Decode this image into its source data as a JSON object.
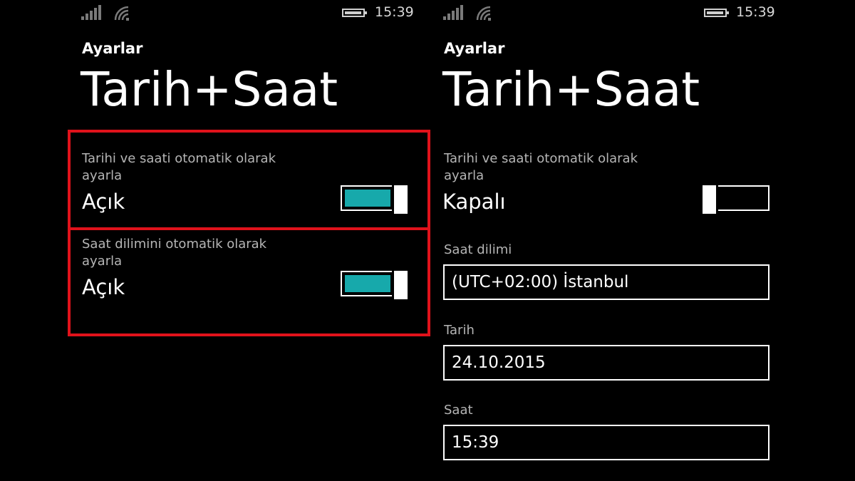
{
  "left": {
    "status": {
      "time": "15:39"
    },
    "app_name": "Ayarlar",
    "title": "Tarih+Saat",
    "auto_datetime": {
      "description": "Tarihi ve saati otomatik olarak ayarla",
      "state": "Açık",
      "toggle_on": true
    },
    "auto_timezone": {
      "description": "Saat dilimini otomatik olarak ayarla",
      "state": "Açık",
      "toggle_on": true
    },
    "highlight_color": "#e0121b"
  },
  "right": {
    "status": {
      "time": "15:39"
    },
    "app_name": "Ayarlar",
    "title": "Tarih+Saat",
    "auto_datetime": {
      "description": "Tarihi ve saati otomatik olarak ayarla",
      "state": "Kapalı",
      "toggle_on": false
    },
    "timezone": {
      "label": "Saat dilimi",
      "value": "(UTC+02:00) İstanbul"
    },
    "date": {
      "label": "Tarih",
      "value": "24.10.2015"
    },
    "time": {
      "label": "Saat",
      "value": "15:39"
    }
  },
  "colors": {
    "accent": "#17a9ab",
    "background": "#000000",
    "secondary_text": "#b5b5b5"
  },
  "icons": [
    "signal-strength-icon",
    "wifi-icon",
    "battery-icon"
  ]
}
